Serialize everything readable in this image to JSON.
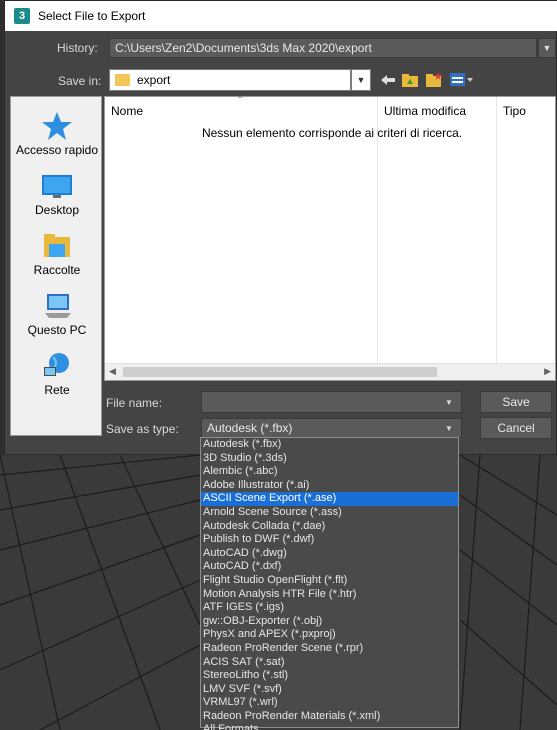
{
  "dialog": {
    "title": "Select File to Export",
    "app_icon": "3"
  },
  "history": {
    "label": "History:",
    "value": "C:\\Users\\Zen2\\Documents\\3ds Max 2020\\export"
  },
  "save_in": {
    "label": "Save in:",
    "value": "export",
    "icons": [
      "back-arrow-icon",
      "up-folder-icon",
      "new-folder-icon",
      "view-menu-icon"
    ]
  },
  "places": [
    {
      "label": "Accesso rapido",
      "icon": "star-icon"
    },
    {
      "label": "Desktop",
      "icon": "desktop-icon"
    },
    {
      "label": "Raccolte",
      "icon": "libraries-icon"
    },
    {
      "label": "Questo PC",
      "icon": "computer-icon"
    },
    {
      "label": "Rete",
      "icon": "network-icon"
    }
  ],
  "filelist": {
    "columns": [
      "Nome",
      "Ultima modifica",
      "Tipo"
    ],
    "empty_message": "Nessun elemento corrisponde ai criteri di ricerca."
  },
  "file_name": {
    "label": "File name:",
    "value": ""
  },
  "save_as_type": {
    "label": "Save as type:",
    "value": "Autodesk (*.fbx)"
  },
  "buttons": {
    "save": "Save",
    "cancel": "Cancel"
  },
  "type_options": [
    "Autodesk (*.fbx)",
    "3D Studio (*.3ds)",
    "Alembic (*.abc)",
    "Adobe Illustrator (*.ai)",
    "ASCII Scene Export (*.ase)",
    "Arnold Scene Source (*.ass)",
    "Autodesk Collada (*.dae)",
    "Publish to DWF (*.dwf)",
    "AutoCAD (*.dwg)",
    "AutoCAD (*.dxf)",
    "Flight Studio OpenFlight (*.flt)",
    "Motion Analysis HTR File (*.htr)",
    "ATF IGES (*.igs)",
    "gw::OBJ-Exporter (*.obj)",
    "PhysX and APEX (*.pxproj)",
    "Radeon ProRender Scene (*.rpr)",
    "ACIS SAT (*.sat)",
    "StereoLitho (*.stl)",
    "LMV SVF (*.svf)",
    "VRML97 (*.wrl)",
    "Radeon ProRender Materials (*.xml)",
    "All Formats"
  ],
  "selected_option": "ASCII Scene Export (*.ase)",
  "colors": {
    "dialog_bg": "#444444",
    "highlight": "#1a6fd6",
    "viewport_bg": "#3a3a3a"
  }
}
